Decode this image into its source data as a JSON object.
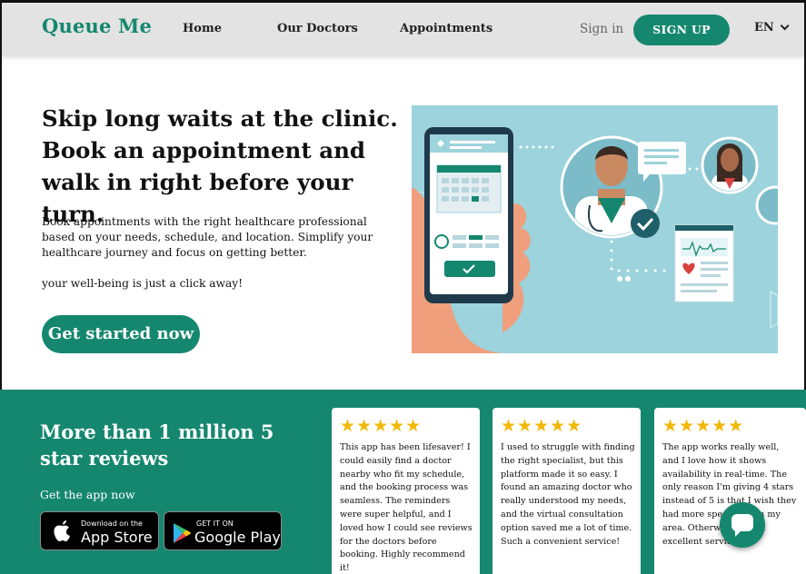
{
  "nav": {
    "logo": "Queue Me",
    "links": [
      "Home",
      "Our Doctors",
      "Appointments"
    ],
    "signin": "Sign in",
    "signup": "SIGN UP",
    "language": "EN"
  },
  "hero": {
    "title": "Skip long waits at the clinic. Book an appointment and walk in right before your turn.",
    "description": "Book appointments with the right healthcare professional based on your needs, schedule, and location. Simplify your healthcare journey and focus on getting better.",
    "tagline": "your well-being is just a click away!",
    "cta": "Get started now"
  },
  "reviews": {
    "title": "More than 1 million 5 star reviews",
    "get_app": "Get the app now",
    "app_store": {
      "small": "Download on the",
      "big": "App Store"
    },
    "google_play": {
      "small": "GET IT ON",
      "big": "Google Play"
    },
    "cards": [
      {
        "stars": "★★★★★",
        "text": "This app has been lifesaver! I could easily find a doctor nearby who fit my schedule, and the booking process was seamless. The reminders were super helpful, and I loved how I could see reviews for the doctors before booking. Highly recommend it!"
      },
      {
        "stars": "★★★★★",
        "text": "I used to struggle with finding the right specialist, but this platform made it so easy. I found an amazing doctor who really understood my needs, and the virtual consultation option saved me a lot of time. Such a convenient service!"
      },
      {
        "stars": "★★★★★",
        "text": "The app works really well, and I love how it shows availability in real-time. The only reason I'm giving 4 stars instead of 5 is that I wish they had more specialists in my area. Otherwise, it's an excellent service!"
      }
    ],
    "next_icon": "double-chevron-right-icon",
    "chat_icon": "chat-bubble-icon"
  },
  "colors": {
    "brand": "#15876f",
    "star": "#f2b807",
    "illustration_bg": "#9dd3dc"
  }
}
